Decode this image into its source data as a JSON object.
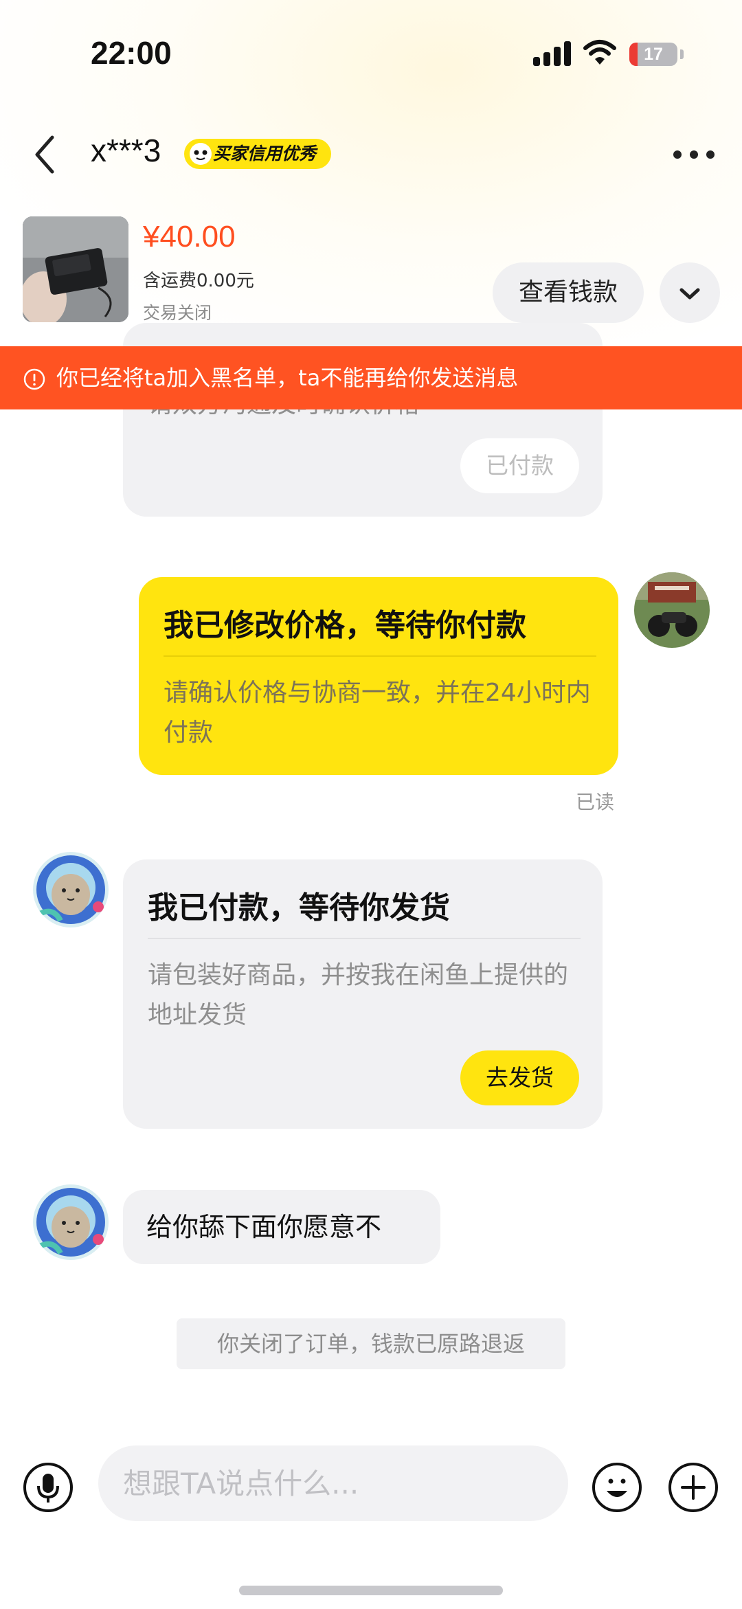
{
  "status_bar": {
    "time": "22:00",
    "battery": "17"
  },
  "header": {
    "title": "x***3",
    "credit_badge": "买家信用优秀"
  },
  "product": {
    "price": "¥40.00",
    "shipping": "含运费0.00元",
    "status": "交易关闭",
    "view_money_button": "查看钱款"
  },
  "banner": {
    "text": "你已经将ta加入黑名单，ta不能再给你发送消息"
  },
  "messages": {
    "partial_card": {
      "body": "请双方沟通及时确认价格",
      "button": "已付款"
    },
    "seller_card": {
      "title": "我已修改价格，等待你付款",
      "body": "请确认价格与协商一致，并在24小时内付款",
      "read_label": "已读"
    },
    "buyer_card": {
      "title": "我已付款，等待你发货",
      "body": "请包装好商品，并按我在闲鱼上提供的地址发货",
      "button": "去发货"
    },
    "buyer_text": "给你舔下面你愿意不",
    "system": "你关闭了订单，钱款已原路退返"
  },
  "input_bar": {
    "placeholder": "想跟TA说点什么..."
  },
  "colors": {
    "accent_yellow": "#ffe40f",
    "banner_orange": "#ff5322",
    "price_orange": "#ff4e1f",
    "bubble_gray": "#f1f1f3"
  },
  "icons": {
    "back": "chevron-left-icon",
    "more": "more-dots-icon",
    "expand": "chevron-down-icon",
    "warning": "exclamation-circle-icon",
    "voice": "microphone-icon",
    "emoji": "emoji-icon",
    "add": "plus-circle-icon"
  }
}
